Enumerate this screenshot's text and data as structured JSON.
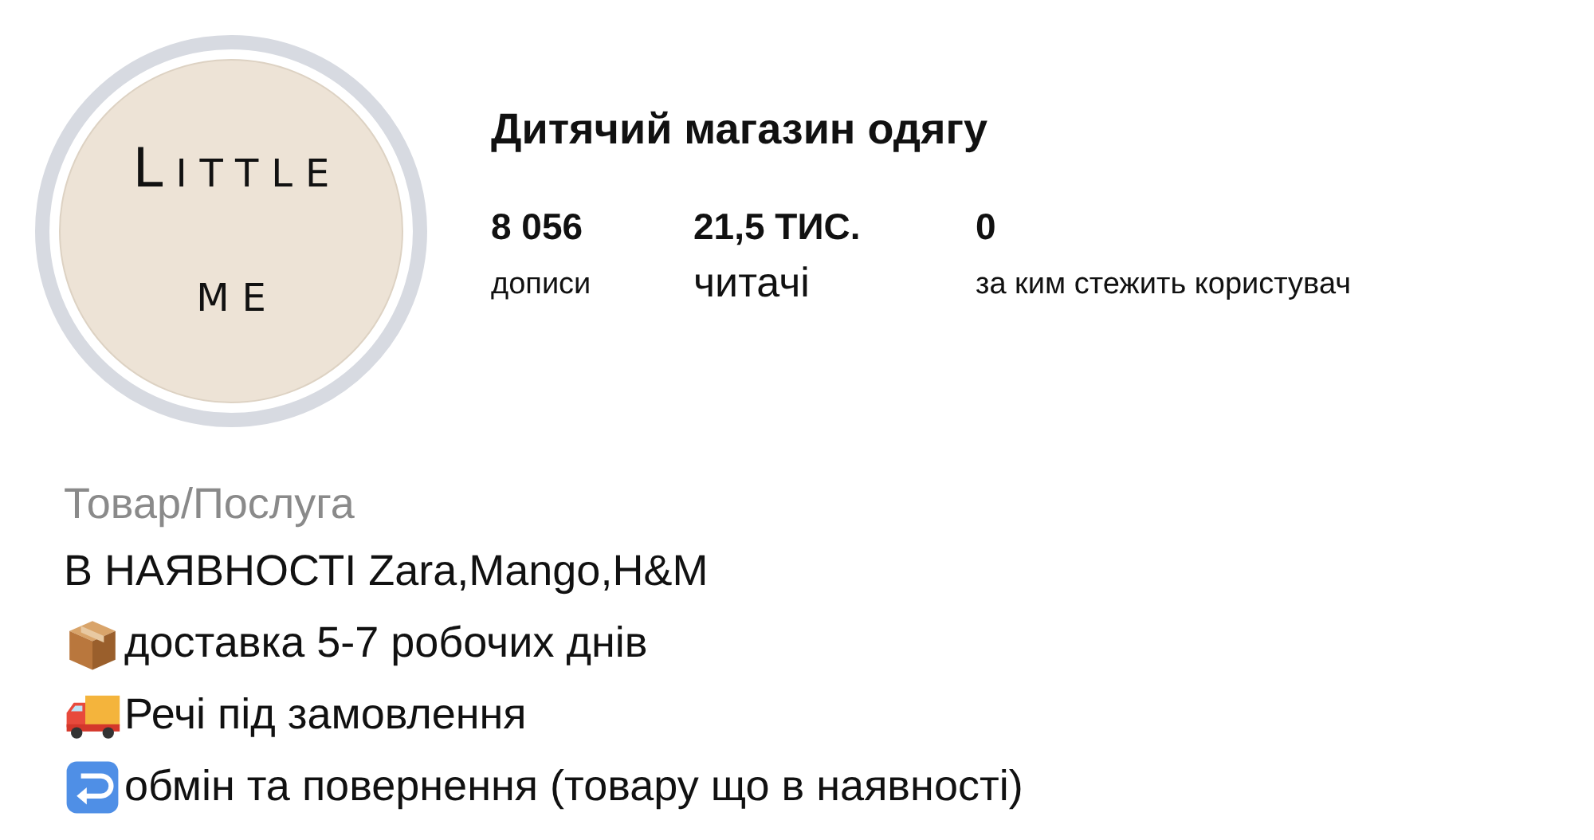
{
  "avatar": {
    "logo_lines": [
      "Little",
      "me"
    ]
  },
  "profile": {
    "name": "Дитячий магазин одягу"
  },
  "stats": [
    {
      "value": "8 056",
      "label": "дописи",
      "kind": "small"
    },
    {
      "value": "21,5 ТИС.",
      "label": "читачі",
      "kind": "large"
    },
    {
      "value": "0",
      "label": "за ким стежить користувач",
      "kind": "small"
    }
  ],
  "bio": {
    "category": "Товар/Послуга",
    "lines": [
      {
        "kind": "text",
        "text": "В НАЯВНОСТІ Zara,Mango,H&M"
      },
      {
        "kind": "box",
        "text": "доставка 5-7 робочих днів"
      },
      {
        "kind": "truck",
        "text": "Речі під замовлення"
      },
      {
        "kind": "return",
        "text": "обмін та повернення (товару що в наявності)"
      }
    ]
  }
}
